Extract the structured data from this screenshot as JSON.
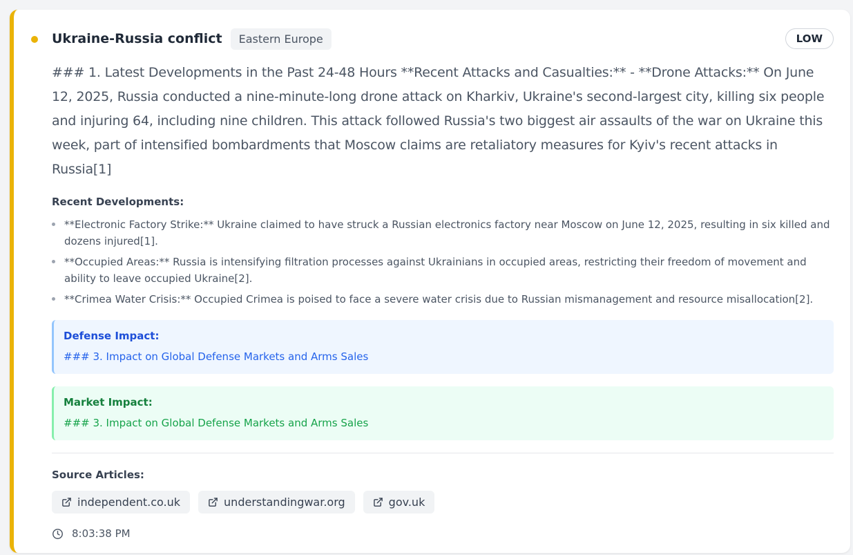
{
  "card": {
    "title": "Ukraine-Russia conflict",
    "region": "Eastern Europe",
    "severity": "LOW",
    "accent_color": "#eab308",
    "summary": "### 1. Latest Developments in the Past 24-48 Hours **Recent Attacks and Casualties:** - **Drone Attacks:** On June 12, 2025, Russia conducted a nine-minute-long drone attack on Kharkiv, Ukraine's second-largest city, killing six people and injuring 64, including nine children. This attack followed Russia's two biggest air assaults of the war on Ukraine this week, part of intensified bombardments that Moscow claims are retaliatory measures for Kyiv's recent attacks in Russia[1]",
    "recent_developments_title": "Recent Developments:",
    "recent_developments": [
      "**Electronic Factory Strike:** Ukraine claimed to have struck a Russian electronics factory near Moscow on June 12, 2025, resulting in six killed and dozens injured[1].",
      "**Occupied Areas:** Russia is intensifying filtration processes against Ukrainians in occupied areas, restricting their freedom of movement and ability to leave occupied Ukraine[2].",
      "**Crimea Water Crisis:** Occupied Crimea is poised to face a severe water crisis due to Russian mismanagement and resource misallocation[2]."
    ],
    "defense_impact": {
      "title": "Defense Impact:",
      "text": "### 3. Impact on Global Defense Markets and Arms Sales"
    },
    "market_impact": {
      "title": "Market Impact:",
      "text": "### 3. Impact on Global Defense Markets and Arms Sales"
    },
    "sources_title": "Source Articles:",
    "sources": [
      {
        "label": "independent.co.uk",
        "icon": "external-link-icon"
      },
      {
        "label": "understandingwar.org",
        "icon": "external-link-icon"
      },
      {
        "label": "gov.uk",
        "icon": "external-link-icon"
      }
    ],
    "timestamp": "8:03:38 PM",
    "timestamp_icon": "clock-icon"
  }
}
